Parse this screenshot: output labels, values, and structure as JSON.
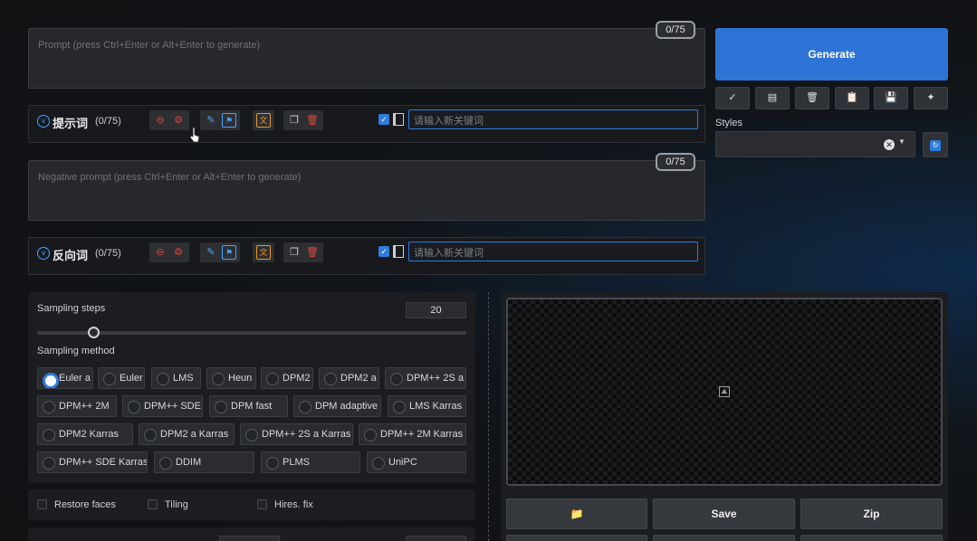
{
  "prompt": {
    "placeholder": "Prompt (press Ctrl+Enter or Alt+Enter to generate)",
    "counter": "0/75",
    "tagbar_title": "提示词",
    "tagbar_count": "(0/75)",
    "keyword_placeholder": "请输入新关键词"
  },
  "negative": {
    "placeholder": "Negative prompt (press Ctrl+Enter or Alt+Enter to generate)",
    "counter": "0/75",
    "tagbar_title": "反向词",
    "tagbar_count": "(0/75)",
    "keyword_placeholder": "请输入新关键词"
  },
  "generate": {
    "label": "Generate"
  },
  "tools": {
    "check": "✓",
    "styles_label": "Styles",
    "styles_value": ""
  },
  "sampling": {
    "steps_label": "Sampling steps",
    "steps_value": "20",
    "steps_fraction": 0.13,
    "method_label": "Sampling method",
    "methods": [
      "Euler a",
      "Euler",
      "LMS",
      "Heun",
      "DPM2",
      "DPM2 a",
      "DPM++ 2S a",
      "DPM++ 2M",
      "DPM++ SDE",
      "DPM fast",
      "DPM adaptive",
      "LMS Karras",
      "DPM2 Karras",
      "DPM2 a Karras",
      "DPM++ 2S a Karras",
      "DPM++ 2M Karras",
      "DPM++ SDE Karras",
      "DDIM",
      "PLMS",
      "UniPC"
    ],
    "selected": "Euler a"
  },
  "options": {
    "restore_faces": "Restore faces",
    "tiling": "Tiling",
    "hires_fix": "Hires. fix"
  },
  "output": {
    "save_label": "Save",
    "zip_label": "Zip"
  },
  "colors": {
    "accent": "#2e74d6",
    "danger": "#e0453a",
    "folder": "#e9962b"
  }
}
